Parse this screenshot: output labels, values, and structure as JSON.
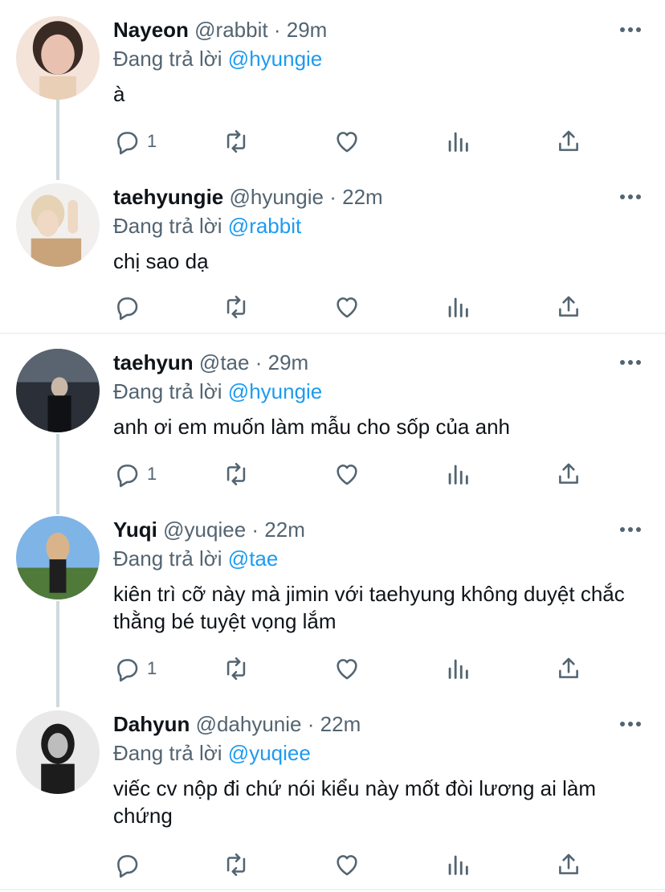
{
  "tweets": [
    {
      "name": "Nayeon",
      "handle": "@rabbit",
      "time": "29m",
      "replying_label": "Đang trả lời",
      "replying_to": "@hyungie",
      "text": "à",
      "reply_count": "1",
      "avatar_colors": [
        "#f3e3d9",
        "#3a2a24",
        "#e8c1b0"
      ]
    },
    {
      "name": "taehyungie",
      "handle": "@hyungie",
      "time": "22m",
      "replying_label": "Đang trả lời",
      "replying_to": "@rabbit",
      "text": "chị sao dạ",
      "reply_count": "",
      "avatar_colors": [
        "#f1f0ee",
        "#e6d2b5",
        "#c9a37a"
      ]
    },
    {
      "name": "taehyun",
      "handle": "@tae",
      "time": "29m",
      "replying_label": "Đang trả lời",
      "replying_to": "@hyungie",
      "text": "anh ơi em muốn làm mẫu cho sốp của anh",
      "reply_count": "1",
      "avatar_colors": [
        "#2b3038",
        "#0f1114",
        "#5a6470"
      ]
    },
    {
      "name": "Yuqi",
      "handle": "@yuqiee",
      "time": "22m",
      "replying_label": "Đang trả lời",
      "replying_to": "@tae",
      "text": "kiên trì cỡ này mà jimin với taehyung không duyệt chắc thằng bé tuyệt vọng lắm",
      "reply_count": "1",
      "avatar_colors": [
        "#7fb4e6",
        "#4f7a3a",
        "#d9b48a"
      ]
    },
    {
      "name": "Dahyun",
      "handle": "@dahyunie",
      "time": "22m",
      "replying_label": "Đang trả lời",
      "replying_to": "@yuqiee",
      "text": "viếc cv nộp đi chứ nói kiểu này mốt đòi lương ai làm chứng",
      "reply_count": "",
      "avatar_colors": [
        "#e9e9e9",
        "#1c1c1c",
        "#bdbdbd"
      ]
    }
  ],
  "icons": {
    "reply": "reply-icon",
    "retweet": "retweet-icon",
    "like": "heart-icon",
    "views": "analytics-icon",
    "share": "share-icon",
    "more": "more-icon"
  },
  "colors": {
    "mention": "#1d9bf0",
    "secondary_text": "#536471",
    "thread_line": "#cfd9de",
    "divider": "#eff3f4"
  }
}
